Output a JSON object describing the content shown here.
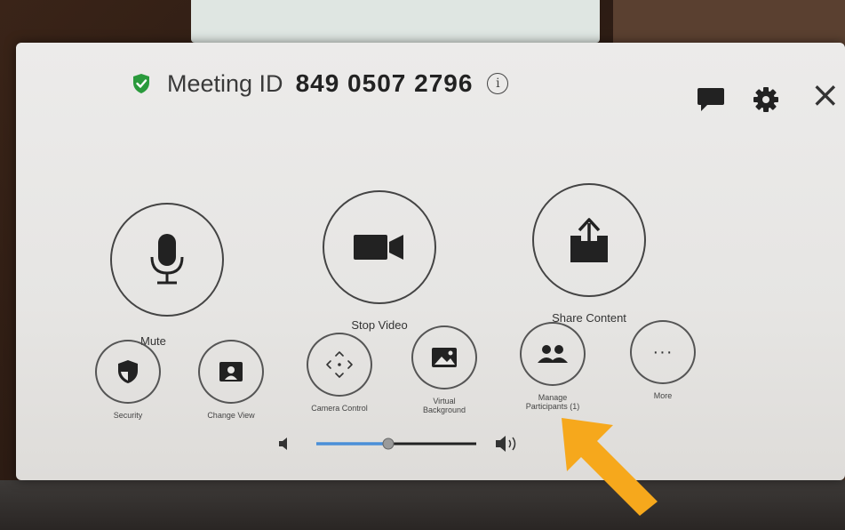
{
  "meeting": {
    "id_label": "Meeting ID",
    "id_value": "849 0507 2796",
    "info_glyph": "i"
  },
  "top_icons": [
    "chat-icon",
    "gear-icon",
    "close-icon"
  ],
  "close_glyph": "×",
  "main_controls": [
    {
      "label": "Mute",
      "icon": "microphone-icon"
    },
    {
      "label": "Stop Video",
      "icon": "video-camera-icon"
    },
    {
      "label": "Share Content",
      "icon": "share-upload-icon"
    }
  ],
  "secondary_controls": [
    {
      "label": "Security",
      "icon": "shield-icon"
    },
    {
      "label": "Change View",
      "icon": "person-frame-icon"
    },
    {
      "label": "Camera Control",
      "icon": "move-arrows-icon"
    },
    {
      "label": "Virtual\nBackground",
      "icon": "image-icon"
    },
    {
      "label": "Manage\nParticipants (1)",
      "icon": "participants-icon"
    },
    {
      "label": "More",
      "icon": "ellipsis-icon",
      "glyph": "···"
    }
  ],
  "volume": {
    "level": 0.45
  },
  "colors": {
    "shield_green": "#2a9a3c",
    "slider_blue": "#4a8fd8",
    "arrow_orange": "#f6a81c",
    "panel_bg": "#e8e7e5"
  }
}
